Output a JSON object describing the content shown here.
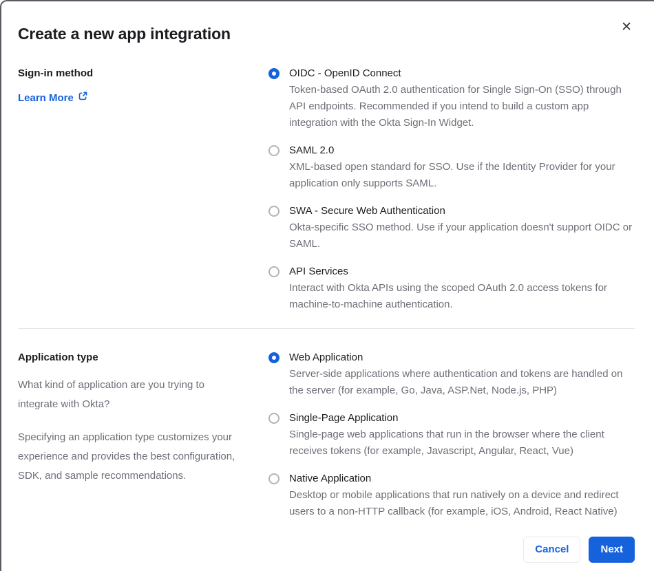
{
  "dialog": {
    "title": "Create a new app integration",
    "close_glyph": "✕"
  },
  "signin": {
    "label": "Sign-in method",
    "learn_more": "Learn More",
    "options": [
      {
        "label": "OIDC - OpenID Connect",
        "description": "Token-based OAuth 2.0 authentication for Single Sign-On (SSO) through API endpoints. Recommended if you intend to build a custom app integration with the Okta Sign-In Widget.",
        "selected": true
      },
      {
        "label": "SAML 2.0",
        "description": "XML-based open standard for SSO. Use if the Identity Provider for your application only supports SAML.",
        "selected": false
      },
      {
        "label": "SWA - Secure Web Authentication",
        "description": "Okta-specific SSO method. Use if your application doesn't support OIDC or SAML.",
        "selected": false
      },
      {
        "label": "API Services",
        "description": "Interact with Okta APIs using the scoped OAuth 2.0 access tokens for machine-to-machine authentication.",
        "selected": false
      }
    ]
  },
  "apptype": {
    "label": "Application type",
    "paragraphs": [
      "What kind of application are you trying to integrate with Okta?",
      "Specifying an application type customizes your experience and provides the best configuration, SDK, and sample recommendations."
    ],
    "options": [
      {
        "label": "Web Application",
        "description": "Server-side applications where authentication and tokens are handled on the server (for example, Go, Java, ASP.Net, Node.js, PHP)",
        "selected": true
      },
      {
        "label": "Single-Page Application",
        "description": "Single-page web applications that run in the browser where the client receives tokens (for example, Javascript, Angular, React, Vue)",
        "selected": false
      },
      {
        "label": "Native Application",
        "description": "Desktop or mobile applications that run natively on a device and redirect users to a non-HTTP callback (for example, iOS, Android, React Native)",
        "selected": false
      }
    ]
  },
  "footer": {
    "cancel_label": "Cancel",
    "next_label": "Next"
  },
  "colors": {
    "accent_blue": "#1662dd",
    "text_dark": "#1d1d21",
    "text_gray": "#6e6e78",
    "divider": "#e6e6ec",
    "frame_border": "#5a5a63"
  }
}
